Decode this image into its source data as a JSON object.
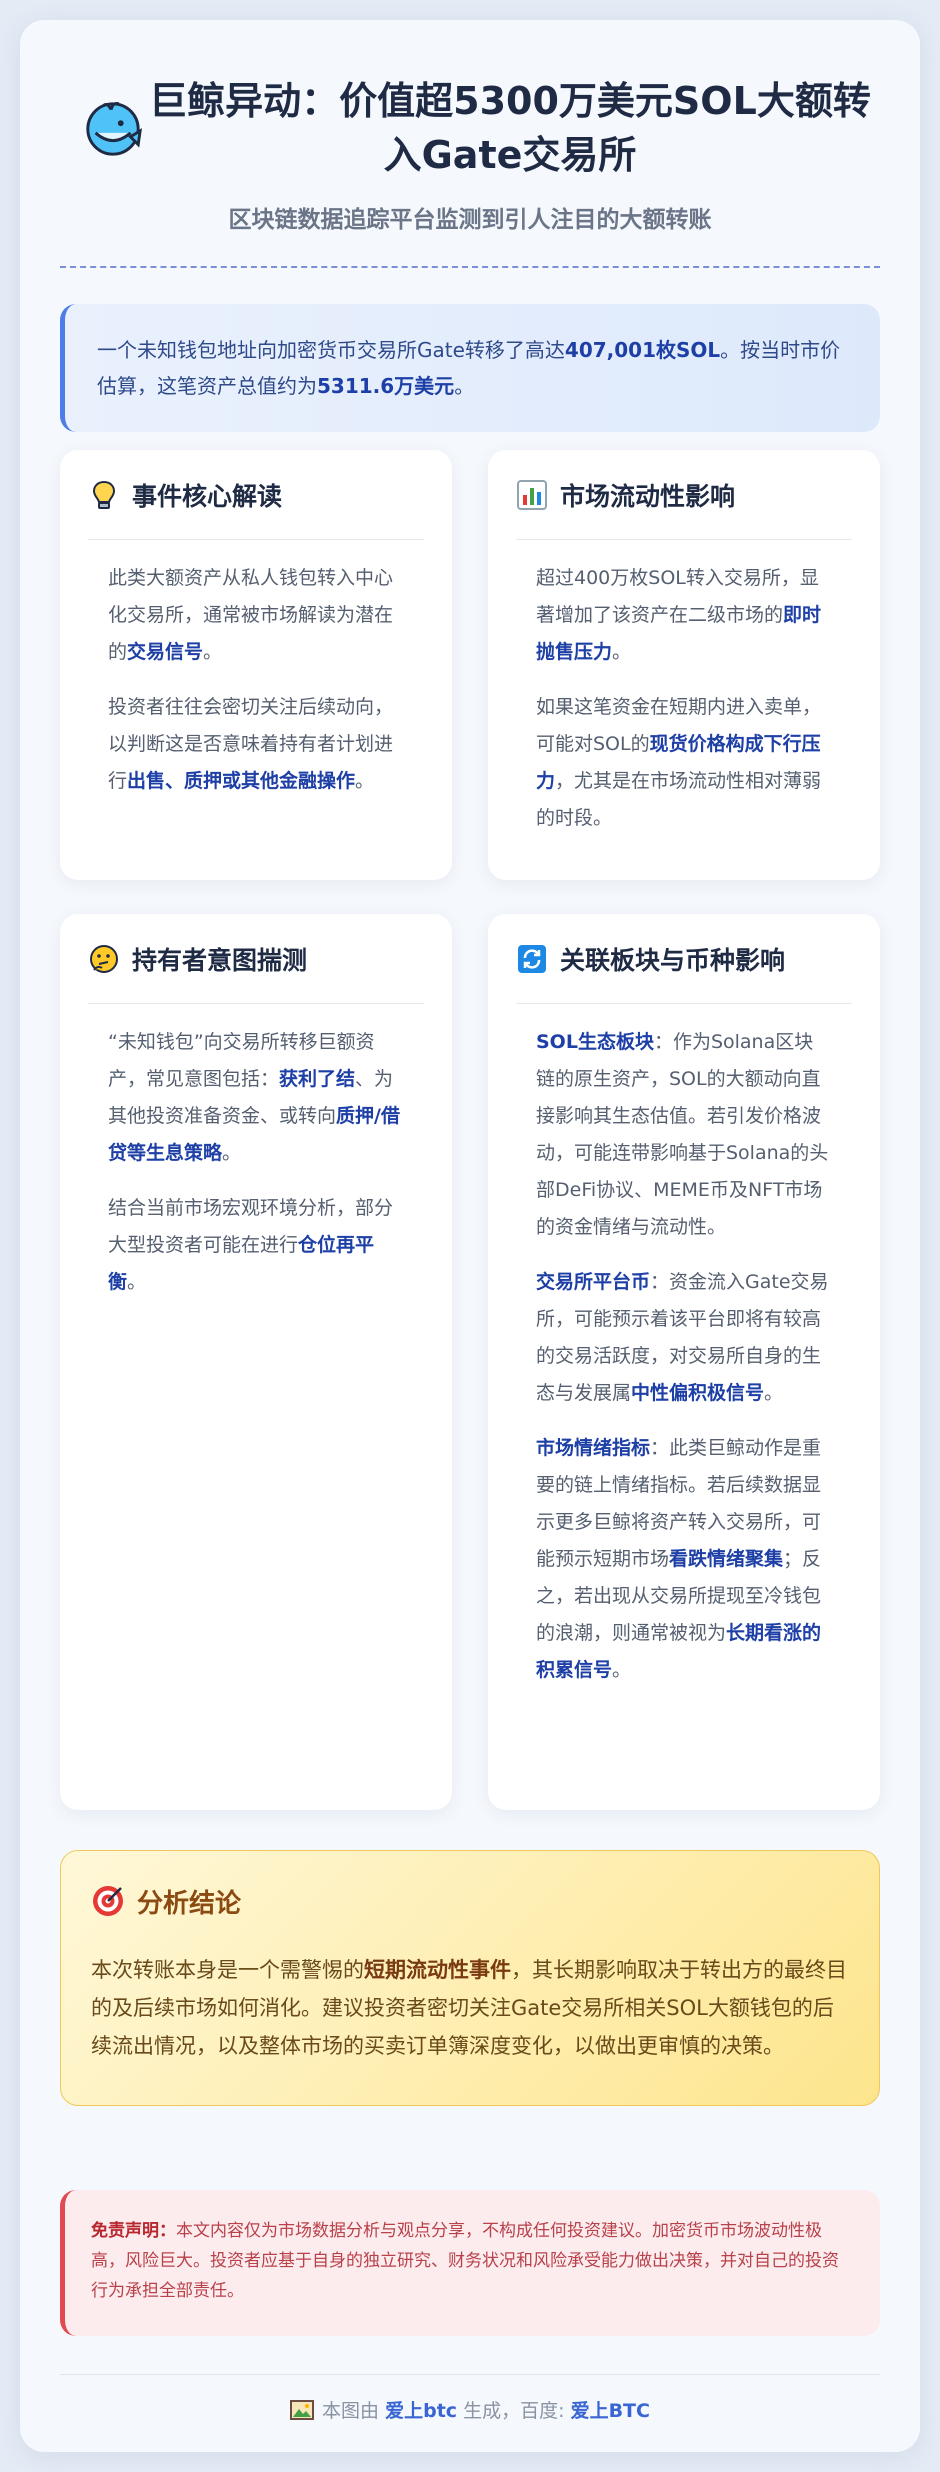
{
  "header": {
    "title": "巨鲸异动：价值超5300万美元SOL大额转入Gate交易所",
    "subtitle": "区块链数据追踪平台监测到引人注目的大额转账",
    "logo_icon": "whale-icon"
  },
  "intro": {
    "text_1": "一个未知钱包地址向加密货币交易所Gate转移了高达",
    "amount": "407,001枚SOL",
    "text_2": "。按当时市价估算，这笔资产总值约为",
    "value": "5311.6万美元",
    "text_3": "。"
  },
  "panels": {
    "core": {
      "icon": "lightbulb-icon",
      "title": "事件核心解读",
      "p1_text": "此类大额资产从私人钱包转入中心化交易所，通常被市场解读为潜在的",
      "p1_bold": "交易信号",
      "p1_end": "。",
      "p2_text": "投资者往往会密切关注后续动向，以判断这是否意味着持有者计划进行",
      "p2_bold": "出售、质押或其他金融操作",
      "p2_end": "。"
    },
    "liquidity": {
      "icon": "bar-chart-icon",
      "title": "市场流动性影响",
      "p1_text": "超过400万枚SOL转入交易所，显著增加了该资产在二级市场的",
      "p1_bold": "即时抛售压力",
      "p1_end": "。",
      "p2_text": "如果这笔资金在短期内进入卖单，可能对SOL的",
      "p2_bold": "现货价格构成下行压力",
      "p2_end": "，尤其是在市场流动性相对薄弱的时段。"
    },
    "intent": {
      "icon": "thinking-face-icon",
      "title": "持有者意图揣测",
      "p1_text": "“未知钱包”向交易所转移巨额资产，常见意图包括：",
      "p1_bold_a": "获利了结",
      "p1_mid": "、为其他投资准备资金、或转向",
      "p1_bold_b": "质押/借贷等生息策略",
      "p1_end": "。",
      "p2_text": "结合当前市场宏观环境分析，部分大型投资者可能在进行",
      "p2_bold": "仓位再平衡",
      "p2_end": "。"
    },
    "related": {
      "icon": "refresh-icon",
      "title": "关联板块与币种影响",
      "i1_lead": "SOL生态板块",
      "i1_text": "：作为Solana区块链的原生资产，SOL的大额动向直接影响其生态估值。若引发价格波动，可能连带影响基于Solana的头部DeFi协议、MEME币及NFT市场的资金情绪与流动性。",
      "i2_lead": "交易所平台币",
      "i2_text": "：资金流入Gate交易所，可能预示着该平台即将有较高的交易活跃度，对交易所自身的生态与发展属",
      "i2_bold": "中性偏积极信号",
      "i2_end": "。",
      "i3_lead": "市场情绪指标",
      "i3_text": "：此类巨鲸动作是重要的链上情绪指标。若后续数据显示更多巨鲸将资产转入交易所，可能预示短期市场",
      "i3_bold_a": "看跌情绪聚集",
      "i3_mid": "；反之，若出现从交易所提现至冷钱包的浪潮，则通常被视为",
      "i3_bold_b": "长期看涨的积累信号",
      "i3_end": "。"
    }
  },
  "conclusion": {
    "icon": "target-icon",
    "title": "分析结论",
    "text_1": "本次转账本身是一个需警惕的",
    "bold": "短期流动性事件",
    "text_2": "，其长期影响取决于转出方的最终目的及后续市场如何消化。建议投资者密切关注Gate交易所相关SOL大额钱包的后续流出情况，以及整体市场的买卖订单簿深度变化，以做出更审慎的决策。"
  },
  "disclaimer": {
    "label": "免责声明：",
    "text": "本文内容仅为市场数据分析与观点分享，不构成任何投资建议。加密货币市场波动性极高，风险巨大。投资者应基于自身的独立研究、财务状况和风险承受能力做出决策，并对自己的投资行为承担全部责任。"
  },
  "footer": {
    "icon": "picture-icon",
    "prefix": "本图由",
    "brand_1": "爱上btc",
    "middle": "生成，百度:",
    "brand_2": "爱上BTC"
  },
  "colors": {
    "accent": "#1d3fa6",
    "intro_border": "#4d7de8",
    "conclusion_bg": "#fde58d",
    "disclaimer_border": "#e04a52"
  }
}
